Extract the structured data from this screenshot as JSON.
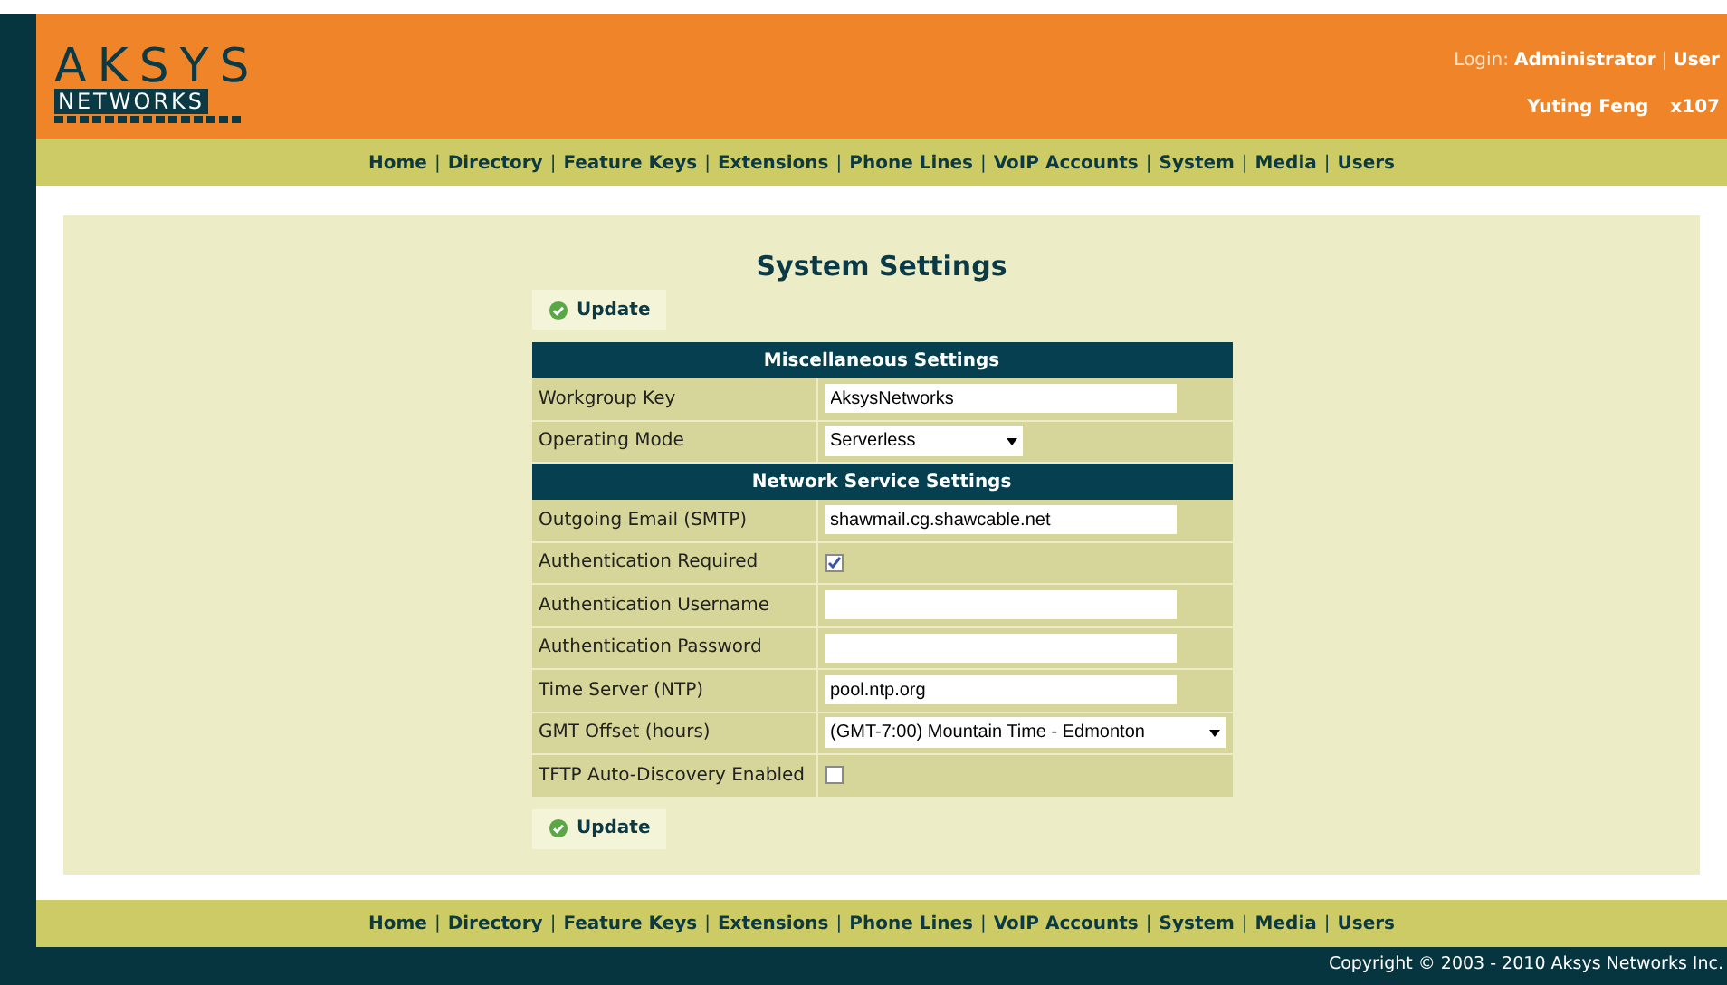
{
  "logo": {
    "line_1": "AKSYS",
    "line_2": "NETWORKS"
  },
  "login": {
    "label": "Login:",
    "user": "Administrator",
    "separator": "|",
    "link": "User"
  },
  "user_name": "Yuting Feng",
  "extension": "x107",
  "top_nav": {
    "separator": "|",
    "items": [
      "Home",
      "Directory",
      "Feature Keys",
      "Extensions",
      "Phone Lines",
      "VoIP Accounts",
      "System",
      "Media",
      "Users"
    ]
  },
  "title": "System Settings",
  "update_top": "Update",
  "rows": [
    {
      "kind": "section",
      "label": "Miscellaneous Settings"
    },
    {
      "kind": "text",
      "label": "Workgroup Key",
      "value": "AksysNetworks"
    },
    {
      "kind": "select",
      "label": "Operating Mode",
      "value": "Serverless"
    },
    {
      "kind": "section",
      "label": "Network Service Settings"
    },
    {
      "kind": "text",
      "label": "Outgoing Email (SMTP)",
      "value": "shawmail.cg.shawcable.net"
    },
    {
      "kind": "checkbox",
      "label": "Authentication Required",
      "checked": true
    },
    {
      "kind": "text",
      "label": "Authentication Username"
    },
    {
      "kind": "text",
      "label": "Authentication Password"
    },
    {
      "kind": "text",
      "label": "Time Server (NTP)",
      "value": "pool.ntp.org"
    },
    {
      "kind": "select",
      "label": "GMT Offset (hours)",
      "value": "(GMT-7:00) Mountain Time - Edmonton"
    },
    {
      "kind": "checkbox",
      "label": "TFTP Auto-Discovery Enabled",
      "checked": false
    }
  ],
  "update_bottom": "Update",
  "bottom_nav": {
    "separator": "|",
    "items": [
      "Home",
      "Directory",
      "Feature Keys",
      "Extensions",
      "Phone Lines",
      "VoIP Accounts",
      "System",
      "Media",
      "Users"
    ]
  },
  "copyright": "Copyright © 2003 - 2010 Aksys Networks Inc."
}
